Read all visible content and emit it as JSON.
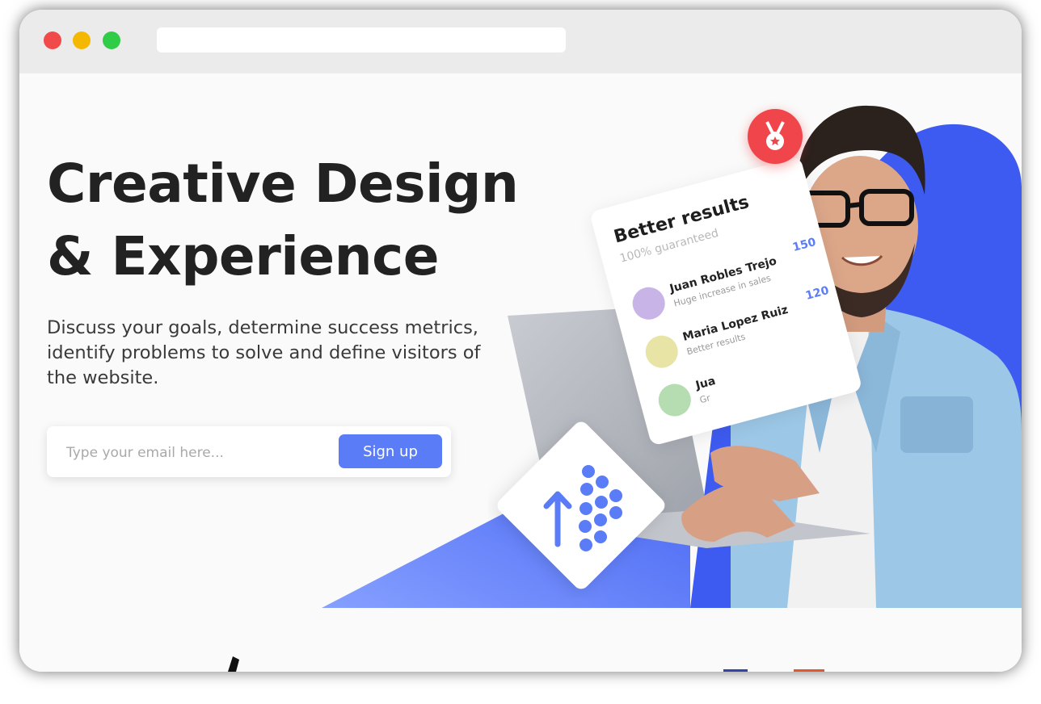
{
  "hero": {
    "headline_line1": "Creative Design",
    "headline_line2": "& Experience",
    "description": "Discuss your goals, determine success metrics, identify problems to solve and define visitors of the website.",
    "email_placeholder": "Type your email here...",
    "signup_label": "Sign up"
  },
  "results_card": {
    "title": "Better results",
    "subtitle": "100% guaranteed",
    "entries": [
      {
        "name": "Juan Robles Trejo",
        "desc": "Huge increase in sales",
        "score": "150"
      },
      {
        "name": "Maria Lopez Ruiz",
        "desc": "Better results",
        "score": "120"
      },
      {
        "name": "Jua",
        "desc": "Gr",
        "score": ""
      }
    ]
  },
  "colors": {
    "accent": "#5b7cf7",
    "medal": "#f0454a",
    "heading": "#222222"
  },
  "icons": {
    "medal": "medal-icon",
    "growth_badge": "growth-arrow-icon"
  }
}
